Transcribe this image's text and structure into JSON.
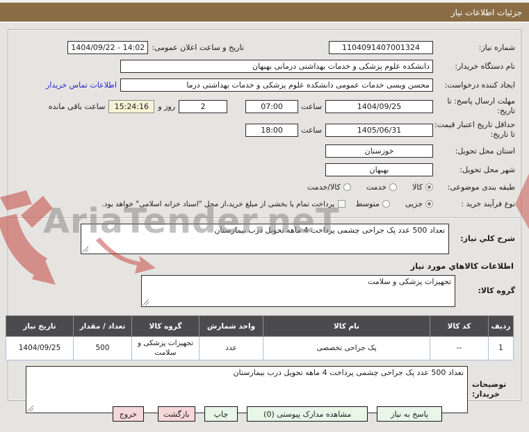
{
  "window": {
    "title": "جزئیات اطلاعات نیاز"
  },
  "watermark": {
    "text": "AriaTender.neT"
  },
  "form": {
    "need_number_label": "شماره نیاز:",
    "need_number_value": "1104091407001324",
    "announce_label": "تاریخ و ساعت اعلان عمومی:",
    "announce_value": "1404/09/22 - 14:02",
    "buyer_org_label": "نام دستگاه خریدار:",
    "buyer_org_value": "دانشکده علوم پزشکی و خدمات بهداشتی  درمانی بهبهان",
    "creator_label": "ایجاد کننده درخواست:",
    "creator_value": "محسن ویسی خدمات عمومی دانشکده علوم پزشکی و خدمات بهداشتی  درما",
    "contact_link": "اطلاعات تماس خریدار",
    "deadline_label": "مهلت ارسال پاسخ: تا تاریخ:",
    "deadline_date": "1404/09/25",
    "hour_label": "ساعت",
    "deadline_hour": "07:00",
    "remaining_days": "2",
    "remaining_days_label": "روز و",
    "remaining_time": "15:24:16",
    "remaining_suffix": "ساعت باقی مانده",
    "validity_label": "حداقل تاریخ اعتبار قیمت: تا تاریخ:",
    "validity_date": "1405/06/31",
    "validity_hour": "18:00",
    "province_label": "استان محل تحویل:",
    "province_value": "خوزستان",
    "city_label": "شهر محل تحویل:",
    "city_value": "بهبهان",
    "classification_label": "طبقه بندی موضوعی:",
    "classification_options": [
      {
        "label": "کالا",
        "selected": true
      },
      {
        "label": "خدمت",
        "selected": false
      },
      {
        "label": "کالا/خدمت",
        "selected": false
      }
    ],
    "process_label": "نوع فرآیند خرید :",
    "process_options": [
      {
        "label": "جزیی",
        "selected": true
      },
      {
        "label": "متوسط",
        "selected": false
      }
    ],
    "treasury_note": "پرداخت تمام یا بخشی از مبلغ خرید،از محل \"اسناد خزانه اسلامی\" خواهد بود."
  },
  "description": {
    "label": "شرح کلي نياز:",
    "value": "تعداد 500 عدد پک  جراحی چشمی پرداخت 4 ماهه تحویل درب بیمارستان"
  },
  "goods": {
    "section_title": "اطلاعات کالاهاي مورد نياز",
    "group_label": "گروه کالا:",
    "group_value": "تجهیزات پزشکی و سلامت"
  },
  "table": {
    "headers": [
      "ردیف",
      "کد کالا",
      "نام کالا",
      "واحد شمارش",
      "گروه کالا",
      "تعداد / مقدار",
      "تاریخ نیاز"
    ],
    "rows": [
      [
        "1",
        "--",
        "پک جراحی تخصصی",
        "عدد",
        "تجهیزات پزشکی و سلامت",
        "500",
        "1404/09/25"
      ]
    ]
  },
  "notes": {
    "label": "توضیحات خریدار:",
    "value": "تعداد 500 عدد پک  جراحی چشمی پرداخت 4 ماهه تحویل درب بیمارستان"
  },
  "buttons": [
    {
      "label": "پاسخ به نیاز",
      "style": "green"
    },
    {
      "label": "مشاهده مدارک پیوستی (0)",
      "style": "green"
    },
    {
      "label": "چاپ",
      "style": "green"
    },
    {
      "label": "بازگشت",
      "style": "pink"
    },
    {
      "label": "خروج",
      "style": "pink"
    }
  ],
  "colors": {
    "header_bar": "#8a6d45",
    "page_bg": "#e6e4e1",
    "table_header_bg": "#4b4b4d",
    "countdown_bg": "#f6f3d5",
    "button_green": "#e7f6e7",
    "button_pink": "#f6d7d7",
    "link": "#2323cc",
    "watermark_red": "#c43b35"
  }
}
